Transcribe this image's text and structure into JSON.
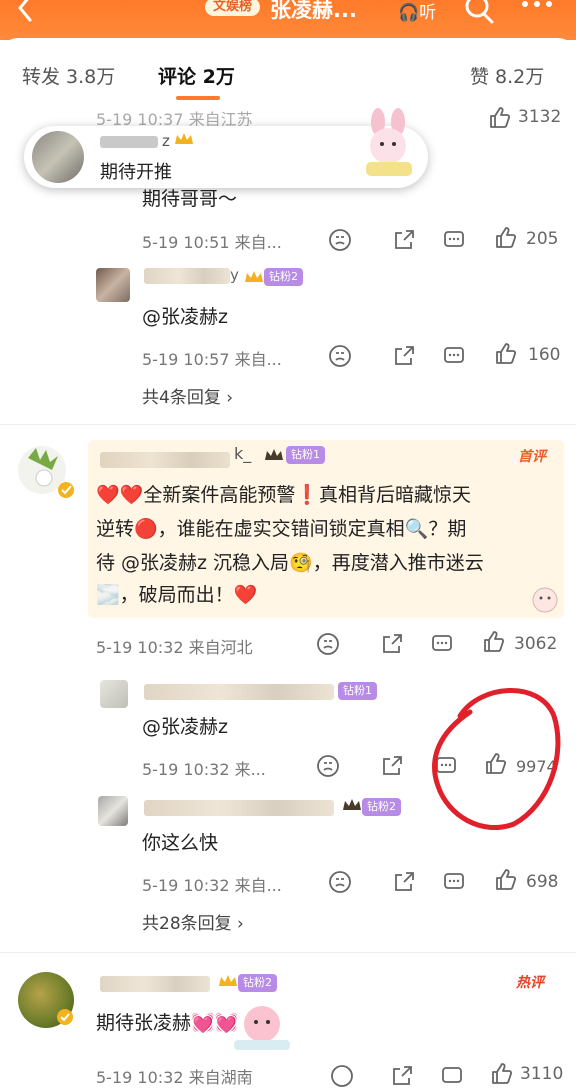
{
  "topbar": {
    "badge": "文娱榜",
    "title": "张凌赫...",
    "listen_label": "听"
  },
  "tabs": {
    "repost": "转发 3.8万",
    "comment": "评论 2万",
    "like": "赞 8.2万"
  },
  "float_pill": {
    "username": "z",
    "text": "期待开推"
  },
  "row0": {
    "meta": "5-19 10:37 来自江苏",
    "likes": "3132"
  },
  "c1": {
    "text_tail": "期待哥哥～",
    "meta": "5-19 10:51 来自...",
    "likes": "205"
  },
  "r1": {
    "username_tail": "y",
    "fan_badge": "钻粉2",
    "text": "@张凌赫z",
    "meta": "5-19 10:57 来自...",
    "likes": "160"
  },
  "c1_replies": "共4条回复 ›",
  "c2": {
    "username_tail": "k_",
    "fan_badge": "钻粉1",
    "tag": "首评",
    "line1": "❤️❤️全新案件高能预警❗真相背后暗藏惊天",
    "line2": "逆转🔴，谁能在虚实交错间锁定真相🔍？期",
    "line3": "待 @张凌赫z 沉稳入局🧐，再度潜入推市迷云",
    "line4": "🌫️，破局而出！❤️",
    "meta": "5-19 10:32 来自河北",
    "likes": "3062"
  },
  "r2": {
    "fan_badge": "钻粉1",
    "text": "@张凌赫z",
    "meta": "5-19 10:32 来...",
    "likes": "9974"
  },
  "r3": {
    "fan_badge": "钻粉2",
    "text": "你这么快",
    "meta": "5-19 10:32 来自...",
    "likes": "698"
  },
  "c2_replies": "共28条回复 ›",
  "c3": {
    "fan_badge": "钻粉2",
    "tag": "热评",
    "text": "期待张凌赫💓💓",
    "meta": "5-19 10:32 来自湖南",
    "likes": "3110"
  },
  "colors": {
    "orange": "#ff7a2a",
    "fan_purple": "#b78be6",
    "circle_red": "#e0202a"
  }
}
